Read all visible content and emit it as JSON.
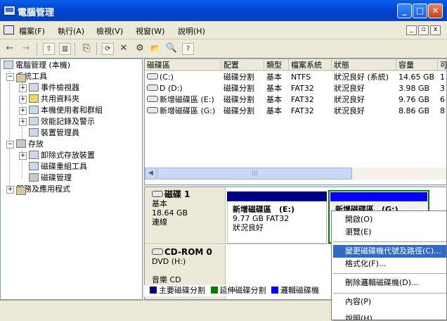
{
  "window": {
    "title": "電腦管理",
    "minimize": "_",
    "maximize": "□",
    "close": "✕"
  },
  "menu": {
    "items": [
      "檔案(F)",
      "執行(A)",
      "檢視(V)",
      "視窗(W)",
      "說明(H)"
    ],
    "mdi": [
      "_",
      "▫",
      "x"
    ]
  },
  "toolbar": {
    "back": "←",
    "forward": "→",
    "up": "⇧",
    "panel": "▥",
    "properties": "⎘",
    "refresh": "⟳",
    "delete": "✕",
    "settings": "⚙",
    "open": "📂",
    "help": "?"
  },
  "tree": {
    "root": "電腦管理 (本機)",
    "system_tools": "系統工具",
    "event_viewer": "事件檢視器",
    "shared_folders": "共用資料夾",
    "local_users": "本機使用者和群組",
    "perf_logs": "效能記錄及警示",
    "device_manager": "裝置管理員",
    "storage": "存放",
    "removable": "卸除式存放裝置",
    "defrag": "磁碟重組工具",
    "disk_mgmt": "磁碟管理",
    "services": "服務及應用程式",
    "expand_plus": "+",
    "expand_minus": "−"
  },
  "volumes": {
    "columns": [
      "磁碟區",
      "配置",
      "類型",
      "檔案系統",
      "狀態",
      "容量",
      "可"
    ],
    "rows": [
      [
        "(C:)",
        "磁碟分割",
        "基本",
        "NTFS",
        "狀況良好 (系統)",
        "14.65 GB",
        "1"
      ],
      [
        "D (D:)",
        "磁碟分割",
        "基本",
        "FAT32",
        "狀況良好",
        "3.98 GB",
        "3"
      ],
      [
        "新增磁碟區 (E:)",
        "磁碟分割",
        "基本",
        "FAT32",
        "狀況良好",
        "9.76 GB",
        "6"
      ],
      [
        "新增磁碟區 (G:)",
        "磁碟分割",
        "基本",
        "FAT32",
        "狀況良好",
        "8.86 GB",
        "8"
      ]
    ],
    "scroll_left": "◀",
    "scroll_grip": "|||"
  },
  "disks": {
    "disk1": {
      "name": "磁碟 1",
      "type": "基本",
      "size": "18.64 GB",
      "status": "連線"
    },
    "part_e": {
      "title": "新增磁碟區　(E:)",
      "size": "9.77 GB FAT32",
      "status": "狀況良好"
    },
    "part_g": {
      "title": "新增磁碟區　(G:)"
    },
    "cdrom": {
      "name": "CD-ROM 0",
      "type": "DVD (H:)",
      "media": "音樂 CD"
    }
  },
  "legend": [
    {
      "label": "主要磁碟分割",
      "color": "#000080"
    },
    {
      "label": "延伸磁碟分割",
      "color": "#008000"
    },
    {
      "label": "邏輯磁碟機",
      "color": "#0000ff"
    }
  ],
  "context_menu": {
    "open": "開啟(O)",
    "explore": "瀏覽(E)",
    "change_letter": "變更磁碟機代號及路徑(C)...",
    "format": "格式化(F)...",
    "delete": "刪除邏輯磁碟機(D)...",
    "properties": "內容(P)",
    "help": "說明(H)"
  },
  "colors": {
    "selection": "#316ac5",
    "title_bar": "#0346d6",
    "primary_partition": "#000080",
    "logical_drive": "#0000ff",
    "extended_partition": "#008000"
  }
}
